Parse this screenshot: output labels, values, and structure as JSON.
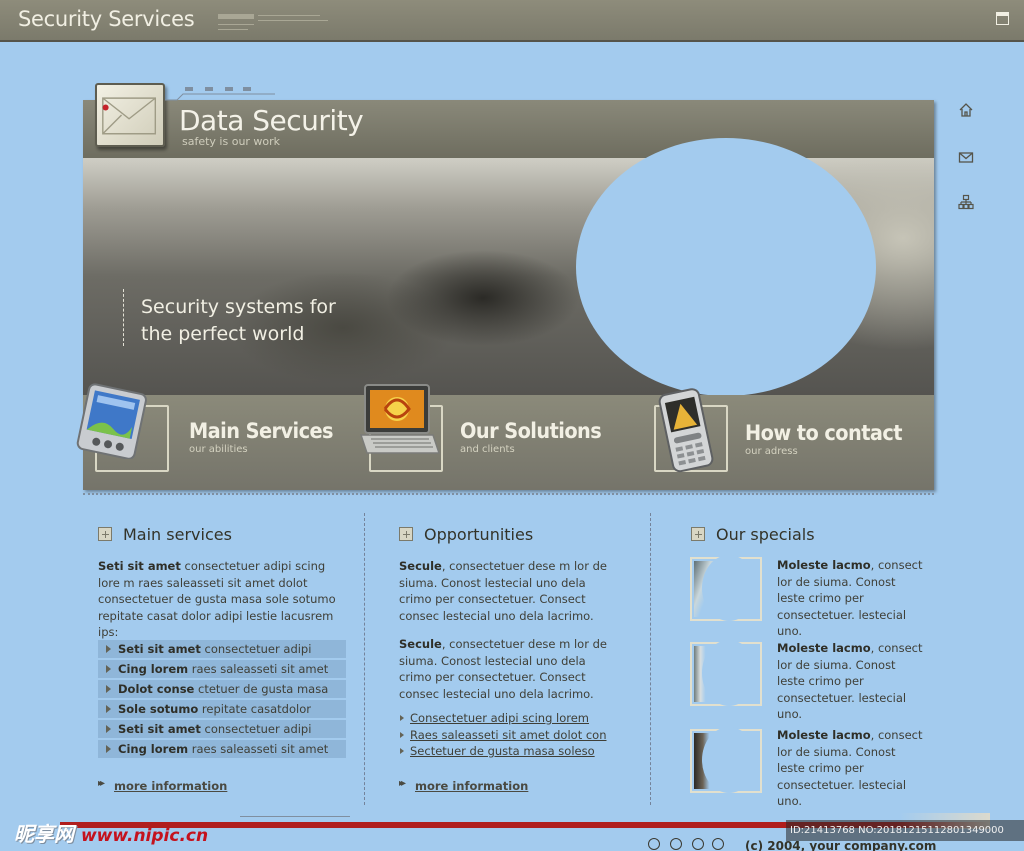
{
  "site": {
    "title": "Security Services"
  },
  "hero": {
    "title": "Data Security",
    "subtitle": "safety is our work",
    "slogan_line1": "Security systems for",
    "slogan_line2": "the perfect world"
  },
  "nav": [
    {
      "label": "Main Services",
      "sub": "our abilities",
      "icon": "pda-icon"
    },
    {
      "label": "Our Solutions",
      "sub": "and clients",
      "icon": "laptop-icon"
    },
    {
      "label": "How to contact",
      "sub": "our adress",
      "icon": "mobile-phone-icon"
    }
  ],
  "side_icons": [
    "home-icon",
    "mail-icon",
    "sitemap-icon"
  ],
  "main_services": {
    "heading": "Main services",
    "intro_bold": "Seti sit amet",
    "intro_text": " consectetuer adipi scing lore m raes saleasseti sit amet dolot consectetuer de gusta masa sole sotumo repitate casat dolor adipi lestie lacusrem ips:",
    "items": [
      {
        "bold": "Seti sit amet",
        "text": " consectetuer adipi"
      },
      {
        "bold": "Cing lorem",
        "text": " raes saleasseti sit amet"
      },
      {
        "bold": "Dolot conse",
        "text": " ctetuer de gusta masa"
      },
      {
        "bold": "Sole sotumo",
        "text": " repitate casatdolor"
      },
      {
        "bold": "Seti sit amet",
        "text": " consectetuer adipi"
      },
      {
        "bold": "Cing lorem",
        "text": " raes saleasseti sit amet"
      }
    ],
    "more": "more information"
  },
  "opportunities": {
    "heading": "Opportunities",
    "paragraphs": [
      {
        "bold": "Secule",
        "text": ", consectetuer dese m lor de siuma. Conost lestecial uno dela crimo per consectetuer. Consect consec lestecial uno dela lacrimo."
      },
      {
        "bold": "Secule",
        "text": ", consectetuer dese m lor de siuma. Conost lestecial uno dela crimo per consectetuer. Consect consec lestecial uno dela lacrimo."
      }
    ],
    "links": [
      "Consectetuer adipi scing lorem",
      "Raes saleasseti sit amet dolot con",
      "Sectetuer de gusta masa soleso"
    ],
    "more": "more information"
  },
  "specials": {
    "heading": "Our specials",
    "items": [
      {
        "bold": "Moleste lacmo",
        "text": ", consect lor de siuma. Conost leste crimo per consectetuer. lestecial uno."
      },
      {
        "bold": "Moleste lacmo",
        "text": ", consect lor de siuma. Conost leste crimo per consectetuer. lestecial uno."
      },
      {
        "bold": "Moleste lacmo",
        "text": ", consect lor de siuma. Conost leste crimo per consectetuer. lestecial uno."
      }
    ]
  },
  "footer": {
    "copyright": "(c) 2004, your company.com"
  },
  "watermark": {
    "logo": "昵享网",
    "url": "www.nipic.cn",
    "id": "ID:21413768 NO:20181215112801349000"
  },
  "colors": {
    "background": "#a3cbee",
    "panel": "#7c7b6b",
    "accent_red": "#b01e1e"
  }
}
